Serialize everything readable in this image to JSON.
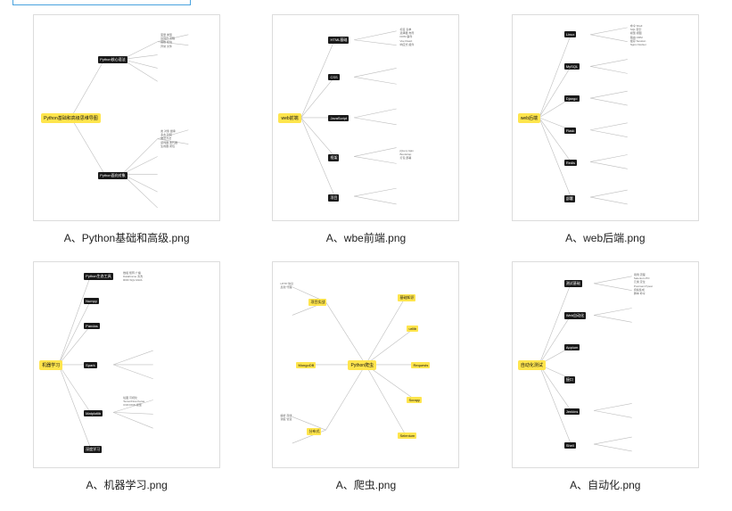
{
  "selection_hint": "partial-item-top-left",
  "files": [
    {
      "name": "A、Python基础和高级.png",
      "thumb_root": "Python基础和高级思维导图",
      "nodes": [
        "Python核心语法",
        "Python面向对象"
      ]
    },
    {
      "name": "A、wbe前端.png",
      "thumb_root": "web前端",
      "nodes": [
        "HTML基础",
        "CSS",
        "JavaScript",
        "框架",
        "项目"
      ]
    },
    {
      "name": "A、web后端.png",
      "thumb_root": "web后端",
      "nodes": [
        "Linux",
        "MySQL",
        "Django",
        "Flask",
        "Redis",
        "部署"
      ]
    },
    {
      "name": "A、机器学习.png",
      "thumb_root": "机器学习",
      "nodes": [
        "Python生态工具",
        "Numpy",
        "Pandas",
        "Spark",
        "Matplotlib",
        "深度学习"
      ]
    },
    {
      "name": "A、爬虫.png",
      "thumb_root": "Python爬虫",
      "nodes": [
        "基础知识",
        "urllib",
        "Requests",
        "Scrapy",
        "Selenium",
        "项目实战",
        "MongoDB"
      ]
    },
    {
      "name": "A、自动化.png",
      "thumb_root": "自动化测试",
      "nodes": [
        "测试基础",
        "Web自动化",
        "Appium",
        "接口",
        "Jenkins",
        "Shell"
      ]
    }
  ]
}
